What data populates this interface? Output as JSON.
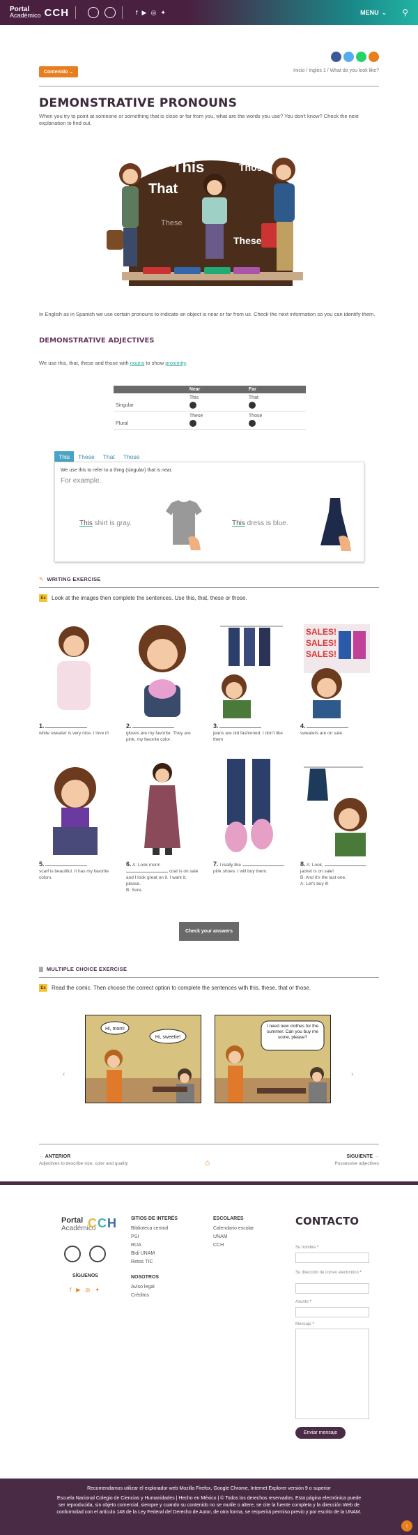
{
  "header": {
    "logo_portal": "Portal",
    "logo_academico": "Académico",
    "logo_cch": "CCH",
    "menu_label": "MENU",
    "colors": {
      "start": "#4a2040",
      "end": "#22b3a3",
      "accent": "#e87e1e"
    }
  },
  "share_icons": [
    "facebook-icon",
    "twitter-icon",
    "whatsapp-icon",
    "share-icon"
  ],
  "contenido_label": "Contenido",
  "breadcrumb": "Inicio / Inglés 1 / What do you look like?",
  "page_title": "DEMONSTRATIVE PRONOUNS",
  "intro": "When you try to point at someone or something that is close or far from you, what are the words you use? You don't know? Check the next explanation to find out.",
  "hero_words": [
    "Those",
    "This",
    "That",
    "These",
    "Those",
    "These"
  ],
  "para2": "In English as in Spanish we use certain pronouns to indicate an object is near or far from us. Check the next information so you can identify them.",
  "section_adjectives": "DEMONSTRATIVE ADJECTIVES",
  "para3": {
    "pre": "We use this, that, these and those with ",
    "nouns": "nouns",
    "mid": " to show ",
    "prox": "proximity",
    "post": "."
  },
  "table": {
    "headers": [
      "",
      "Near",
      "Far"
    ],
    "rows": [
      [
        "Singular",
        "This",
        "That"
      ],
      [
        "Plural",
        "These",
        "Those"
      ]
    ]
  },
  "tabs": [
    "This",
    "These",
    "That",
    "Those"
  ],
  "tab_panel": {
    "rule": "We use this to refer to a thing (singular) that is near.",
    "for_example": "For example.",
    "ex1_word": "This",
    "ex1_rest": " shirt is gray.",
    "ex2_word": "This",
    "ex2_rest": " dress is blue."
  },
  "writing": {
    "title": "WRITING EXERCISE",
    "badge": "Ex",
    "instruction": "Look at the images then complete the sentences. Use this, that, these or those.",
    "items": [
      {
        "n": "1.",
        "pre": "",
        "post": " white sweater is very nice. I love it!"
      },
      {
        "n": "2.",
        "pre": "",
        "post": " gloves are my favorite. They are pink, my favorite color."
      },
      {
        "n": "3.",
        "pre": "",
        "post": " jeans are old fashioned. I don't like them"
      },
      {
        "n": "4.",
        "pre": "",
        "post": " sweaters are on sale."
      },
      {
        "n": "5.",
        "pre": "",
        "post": " scarf is beautiful. It has my favorite colors."
      },
      {
        "n": "6.",
        "pre": "A: Look mom! ",
        "post": " coat is on sale and I look great on it. I want it, please.",
        "extra": "B: Sure."
      },
      {
        "n": "7.",
        "pre": "I really like ",
        "post": " pink shoes. I will buy them."
      },
      {
        "n": "8.",
        "pre": "A: Look, ",
        "post": " jacket is on sale!",
        "extra": "B: And it's the last one.",
        "extra2": "A: Let's buy it!"
      }
    ],
    "check_button": "Check your answers"
  },
  "multiple": {
    "title": "MULTIPLE CHOICE EXERCISE",
    "badge": "Ex",
    "instruction": "Read the comic. Then choose the correct option to complete the sentences with this, these, that or those.",
    "bubbles": [
      "Hi, mom!",
      "Hi, sweetie!",
      "I need new clothes for the summer. Can you buy me some, please?"
    ]
  },
  "pager": {
    "prev_label": "ANTERIOR",
    "prev_title": "Adjectives to describe size, color and quality",
    "next_label": "SIGUIENTE",
    "next_title": "Possessive adjectives"
  },
  "footer": {
    "siguenos": "SÍGUENOS",
    "sitios_title": "SITIOS DE INTERÉS",
    "sitios": [
      "Biblioteca central",
      "PSI",
      "RUA",
      "Bidi UNAM",
      "Retos TIC"
    ],
    "nosotros_title": "NOSOTROS",
    "nosotros": [
      "Aviso legal",
      "Créditos"
    ],
    "escolares_title": "ESCOLARES",
    "escolares": [
      "Calendario escolar",
      "UNAM",
      "CCH"
    ],
    "contacto": "CONTACTO",
    "f_name": "Su nombre",
    "f_email": "Su dirección de correo electrónico",
    "f_subject": "Asunto",
    "f_message": "Mensaje",
    "send": "Enviar mensaje"
  },
  "bottom": {
    "line1": "Recomendamos utilizar el explorador web Mozilla Firefox, Google Chrome, Internet Explorer versión 9 o superior",
    "line2": "Escuela Nacional Colegio de Ciencias y Humanidades | Hecho en México | © Todos los derechos reservados. Esta página electrónica puede ser reproducida, sin objeto comercial, siempre y cuando su contenido no se mutile o altere, se cite la fuente completa y la dirección Web de conformidad con el artículo 148 de la Ley Federal del Derecho de Autor, de otra forma, se requerirá permiso previo y por escrito de la UNAM."
  }
}
